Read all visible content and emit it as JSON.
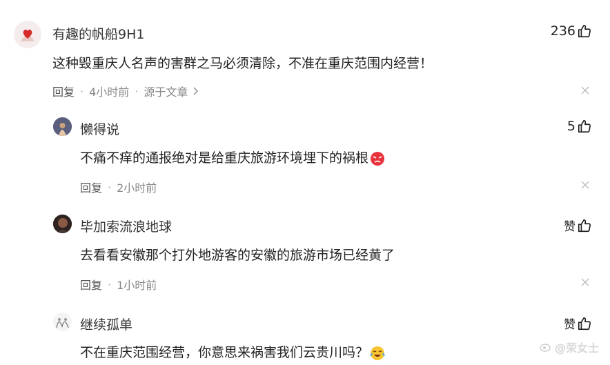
{
  "comments": [
    {
      "user": "有趣的帆船9H1",
      "text": "这种毁重庆人名声的害群之马必须清除，不准在重庆范围内经营！",
      "reply_label": "回复",
      "time": "4小时前",
      "source_label": "源于文章",
      "likes": "236"
    },
    {
      "user": "懒得说",
      "text": "不痛不痒的通报绝对是给重庆旅游环境埋下的祸根",
      "reply_label": "回复",
      "time": "2小时前",
      "likes": "5"
    },
    {
      "user": "毕加索流浪地球",
      "text": "去看看安徽那个打外地游客的安徽的旅游市场已经黄了",
      "reply_label": "回复",
      "time": "1小时前",
      "likes": "赞"
    },
    {
      "user": "继续孤单",
      "text": "不在重庆范围经营，你意思来祸害我们云贵川吗？",
      "likes": "赞"
    }
  ],
  "watermark": "@荣女士",
  "colors": {
    "text": "#222222",
    "meta": "#888888",
    "background": "#ffffff"
  }
}
